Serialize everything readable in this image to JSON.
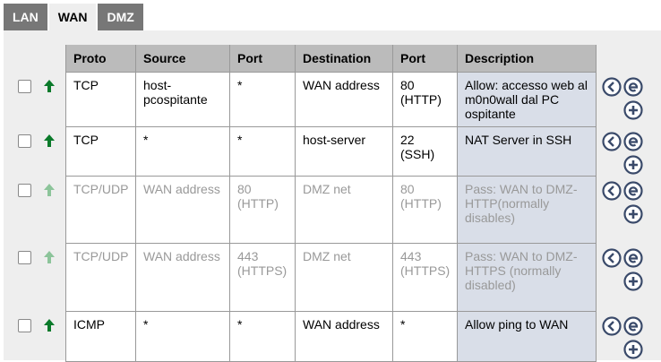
{
  "tabs": [
    {
      "label": "LAN",
      "active": false
    },
    {
      "label": "WAN",
      "active": true
    },
    {
      "label": "DMZ",
      "active": false
    }
  ],
  "columns": [
    "Proto",
    "Source",
    "Port",
    "Destination",
    "Port",
    "Description"
  ],
  "rules": [
    {
      "enabled": true,
      "proto": "TCP",
      "source": "host-pcospitante",
      "port": "*",
      "destination": "WAN address",
      "dport": "80 (HTTP)",
      "description": "Allow: accesso web al m0n0wall dal PC ospitante"
    },
    {
      "enabled": true,
      "proto": "TCP",
      "source": "*",
      "port": "*",
      "destination": "host-server",
      "dport": "22 (SSH)",
      "description": "NAT Server in SSH"
    },
    {
      "enabled": false,
      "proto": "TCP/UDP",
      "source": "WAN address",
      "port": "80 (HTTP)",
      "destination": "DMZ net",
      "dport": "80 (HTTP)",
      "description": "Pass: WAN to DMZ-HTTP(normally disables)"
    },
    {
      "enabled": false,
      "proto": "TCP/UDP",
      "source": "WAN address",
      "port": "443 (HTTPS)",
      "destination": "DMZ net",
      "dport": "443 (HTTPS)",
      "description": "Pass: WAN to DMZ-HTTPS (normally disabled)"
    },
    {
      "enabled": true,
      "proto": "ICMP",
      "source": "*",
      "port": "*",
      "destination": "WAN address",
      "dport": "*",
      "description": "Allow ping to WAN"
    }
  ],
  "icons": {
    "pass_arrow": "arrow-up-icon",
    "move": "move-left-icon",
    "edit": "edit-icon",
    "add": "add-icon"
  },
  "colors": {
    "pass_enabled": "#0a7a2a",
    "pass_disabled": "#8cc49a",
    "header_bg": "#bbbbbb",
    "desc_bg": "#d9dee8",
    "action_icon": "#3a4a6a"
  }
}
